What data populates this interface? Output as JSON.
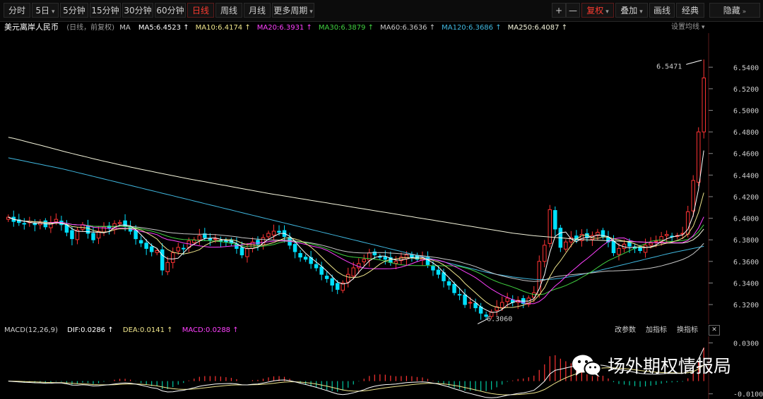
{
  "toolbar": {
    "left": [
      {
        "label": "分时"
      },
      {
        "label": "5日",
        "caret": "▾"
      },
      {
        "label": "5分钟"
      },
      {
        "label": "15分钟"
      },
      {
        "label": "30分钟"
      },
      {
        "label": "60分钟"
      },
      {
        "label": "日线",
        "active": true
      },
      {
        "label": "周线"
      },
      {
        "label": "月线"
      },
      {
        "label": "更多周期",
        "caret": "▾"
      }
    ],
    "right": [
      {
        "label": "+"
      },
      {
        "label": "—"
      },
      {
        "label": "复权",
        "caret": "▾",
        "active": true
      },
      {
        "label": "叠加",
        "caret": "▾"
      },
      {
        "label": "画线"
      },
      {
        "label": "经典"
      },
      {
        "label": "隐藏",
        "caret": "»"
      }
    ]
  },
  "header": {
    "symbol": "美元离岸人民币",
    "period": "(日线，前复权)",
    "ma_label": "MA",
    "settings": "设置均线",
    "settings_caret": "▾",
    "ma": [
      {
        "label": "MA5:6.4523",
        "arrow": "↑",
        "color": "#ffffff"
      },
      {
        "label": "MA10:6.4174",
        "arrow": "↑",
        "color": "#f0e68c"
      },
      {
        "label": "MA20:6.3931",
        "arrow": "↑",
        "color": "#ff40ff"
      },
      {
        "label": "MA30:6.3879",
        "arrow": "↑",
        "color": "#40d040"
      },
      {
        "label": "MA60:6.3636",
        "arrow": "↑",
        "color": "#c8c8c8"
      },
      {
        "label": "MA120:6.3686",
        "arrow": "↑",
        "color": "#40b8e0"
      },
      {
        "label": "MA250:6.4087",
        "arrow": "↑",
        "color": "#f5f5dc"
      }
    ]
  },
  "macd_header": {
    "title": "MACD(12,26,9)",
    "dif": "DIF:0.0286",
    "dif_arrow": "↑",
    "dea": "DEA:0.0141",
    "dea_arrow": "↑",
    "macd": "MACD:0.0288",
    "macd_arrow": "↑",
    "buttons": [
      "改参数",
      "加指标",
      "换指标"
    ],
    "close": "✕"
  },
  "colors": {
    "up": "#ff3333",
    "down": "#00e0ff",
    "ma5": "#ffffff",
    "ma10": "#f0e68c",
    "ma20": "#ff40ff",
    "ma30": "#40d040",
    "ma60": "#c8c8c8",
    "ma120": "#40b8e0",
    "ma250": "#f5f5dc"
  },
  "watermark": "场外期权情报局",
  "chart_data": [
    {
      "type": "candlestick",
      "title": "美元离岸人民币",
      "y_ticks": [
        "6.5400",
        "6.5200",
        "6.5000",
        "6.4800",
        "6.4600",
        "6.4400",
        "6.4200",
        "6.4000",
        "6.3800",
        "6.3600",
        "6.3400",
        "6.3200"
      ],
      "ylim": [
        6.305,
        6.565
      ],
      "annotations": [
        {
          "label": "6.5471",
          "value": 6.5471,
          "kind": "high"
        },
        {
          "label": "6.3060",
          "value": 6.306,
          "kind": "low"
        }
      ],
      "closes": [
        6.401,
        6.397,
        6.396,
        6.395,
        6.397,
        6.394,
        6.396,
        6.392,
        6.396,
        6.399,
        6.394,
        6.387,
        6.381,
        6.389,
        6.394,
        6.386,
        6.38,
        6.388,
        6.392,
        6.391,
        6.395,
        6.396,
        6.393,
        6.388,
        6.381,
        6.377,
        6.372,
        6.369,
        6.37,
        6.352,
        6.359,
        6.368,
        6.373,
        6.372,
        6.379,
        6.38,
        6.384,
        6.382,
        6.38,
        6.381,
        6.379,
        6.378,
        6.377,
        6.372,
        6.366,
        6.372,
        6.378,
        6.376,
        6.382,
        6.386,
        6.388,
        6.387,
        6.383,
        6.375,
        6.369,
        6.364,
        6.362,
        6.358,
        6.354,
        6.348,
        6.344,
        6.338,
        6.334,
        6.34,
        6.348,
        6.354,
        6.358,
        6.362,
        6.368,
        6.366,
        6.364,
        6.362,
        6.359,
        6.36,
        6.364,
        6.366,
        6.364,
        6.362,
        6.363,
        6.357,
        6.352,
        6.348,
        6.342,
        6.338,
        6.331,
        6.329,
        6.32,
        6.322,
        6.317,
        6.312,
        6.309,
        6.313,
        6.318,
        6.322,
        6.326,
        6.322,
        6.324,
        6.321,
        6.326,
        6.331,
        6.36,
        6.375,
        6.408,
        6.39,
        6.373,
        6.378,
        6.382,
        6.38,
        6.385,
        6.382,
        6.384,
        6.387,
        6.383,
        6.378,
        6.368,
        6.372,
        6.376,
        6.374,
        6.372,
        6.37,
        6.375,
        6.377,
        6.379,
        6.383,
        6.385,
        6.383,
        6.384,
        6.386,
        6.406,
        6.435,
        6.48,
        6.53
      ],
      "ma250": [
        6.475,
        6.474,
        6.4728,
        6.4715,
        6.4702,
        6.469,
        6.4677,
        6.4664,
        6.4651,
        6.4638,
        6.4625,
        6.4612,
        6.46,
        6.4588,
        6.4576,
        6.4564,
        6.4552,
        6.454,
        6.4529,
        6.4518,
        6.4507,
        6.4496,
        6.4485,
        6.4474,
        6.4464,
        6.4454,
        6.4444,
        6.4434,
        6.4424,
        6.4414,
        6.4404,
        6.4394,
        6.4384,
        6.4374,
        6.4365,
        6.4356,
        6.4347,
        6.4338,
        6.4329,
        6.432,
        6.4311,
        6.4302,
        6.4293,
        6.4284,
        6.4275,
        6.4266,
        6.4257,
        6.4248,
        6.4239,
        6.423,
        6.4222,
        6.4214,
        6.4206,
        6.4198,
        6.419,
        6.4182,
        6.4174,
        6.4166,
        6.4158,
        6.415,
        6.4142,
        6.4134,
        6.4126,
        6.4118,
        6.411,
        6.4102,
        6.4094,
        6.4086,
        6.4078,
        6.407,
        6.4062,
        6.4054,
        6.4046,
        6.4038,
        6.403,
        6.4022,
        6.4014,
        6.4006,
        6.3998,
        6.399,
        6.3982,
        6.3974,
        6.3966,
        6.3958,
        6.395,
        6.3942,
        6.3934,
        6.3926,
        6.3918,
        6.391,
        6.3902,
        6.3894,
        6.3886,
        6.3878,
        6.387,
        6.3862,
        6.3856,
        6.385,
        6.3844,
        6.3838,
        6.3834,
        6.383,
        6.3826,
        6.3822,
        6.3818,
        6.3814,
        6.381,
        6.3806,
        6.3802,
        6.38,
        6.3798,
        6.3796,
        6.3794,
        6.3792,
        6.379,
        6.3788,
        6.3786,
        6.3784,
        6.3782,
        6.378,
        6.3778,
        6.3776,
        6.3774,
        6.3772,
        6.377,
        6.377,
        6.377,
        6.377,
        6.378,
        6.38,
        6.384,
        6.39
      ],
      "ma120": [
        6.456,
        6.455,
        6.454,
        6.453,
        6.452,
        6.451,
        6.45,
        6.449,
        6.448,
        6.447,
        6.446,
        6.4448,
        6.4436,
        6.4424,
        6.4412,
        6.44,
        6.4388,
        6.4376,
        6.4364,
        6.4352,
        6.434,
        6.4328,
        6.4316,
        6.4304,
        6.4292,
        6.428,
        6.4268,
        6.4256,
        6.4244,
        6.4232,
        6.422,
        6.4208,
        6.4196,
        6.4184,
        6.4172,
        6.416,
        6.4148,
        6.4136,
        6.4124,
        6.4112,
        6.41,
        6.4088,
        6.4076,
        6.4064,
        6.4052,
        6.404,
        6.4028,
        6.4016,
        6.4004,
        6.3992,
        6.398,
        6.3968,
        6.3956,
        6.3944,
        6.3932,
        6.392,
        6.3908,
        6.3896,
        6.3884,
        6.3872,
        6.386,
        6.3848,
        6.3836,
        6.3824,
        6.3812,
        6.38,
        6.3788,
        6.3776,
        6.3764,
        6.3752,
        6.374,
        6.3728,
        6.3716,
        6.3704,
        6.3692,
        6.368,
        6.3668,
        6.3656,
        6.3644,
        6.3632,
        6.362,
        6.3608,
        6.3596,
        6.3584,
        6.3572,
        6.356,
        6.3548,
        6.3536,
        6.3524,
        6.3512,
        6.35,
        6.349,
        6.348,
        6.3472,
        6.3464,
        6.3456,
        6.345,
        6.3444,
        6.3438,
        6.3434,
        6.3432,
        6.3432,
        6.3434,
        6.3438,
        6.3444,
        6.3452,
        6.346,
        6.347,
        6.348,
        6.349,
        6.35,
        6.3512,
        6.3524,
        6.3536,
        6.3548,
        6.356,
        6.3572,
        6.3584,
        6.3596,
        6.3608,
        6.362,
        6.3632,
        6.3644,
        6.3656,
        6.3668,
        6.368,
        6.369,
        6.37,
        6.371,
        6.372,
        6.373,
        6.374
      ]
    },
    {
      "type": "bar",
      "title": "MACD(12,26,9)",
      "y_ticks": [
        "0.0300",
        "-0.0100"
      ],
      "ylim": [
        -0.0135,
        0.0335
      ]
    }
  ]
}
